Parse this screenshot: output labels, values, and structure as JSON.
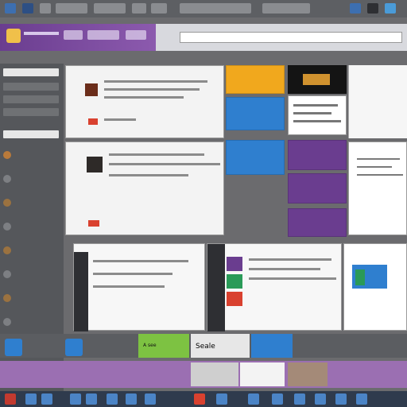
{
  "taskbar": {
    "items": [
      "",
      "",
      "",
      "",
      "",
      "",
      "",
      "",
      "",
      "",
      "",
      "",
      "",
      "",
      "",
      ""
    ]
  },
  "tiles": {
    "bottom_banner_text": "Seale",
    "banner_left_text": "A see"
  },
  "colors": {
    "orange": "#f1a81d",
    "blue": "#2f7fcf",
    "purple": "#6a3d8f",
    "green": "#7dc242",
    "red": "#d9412f"
  }
}
